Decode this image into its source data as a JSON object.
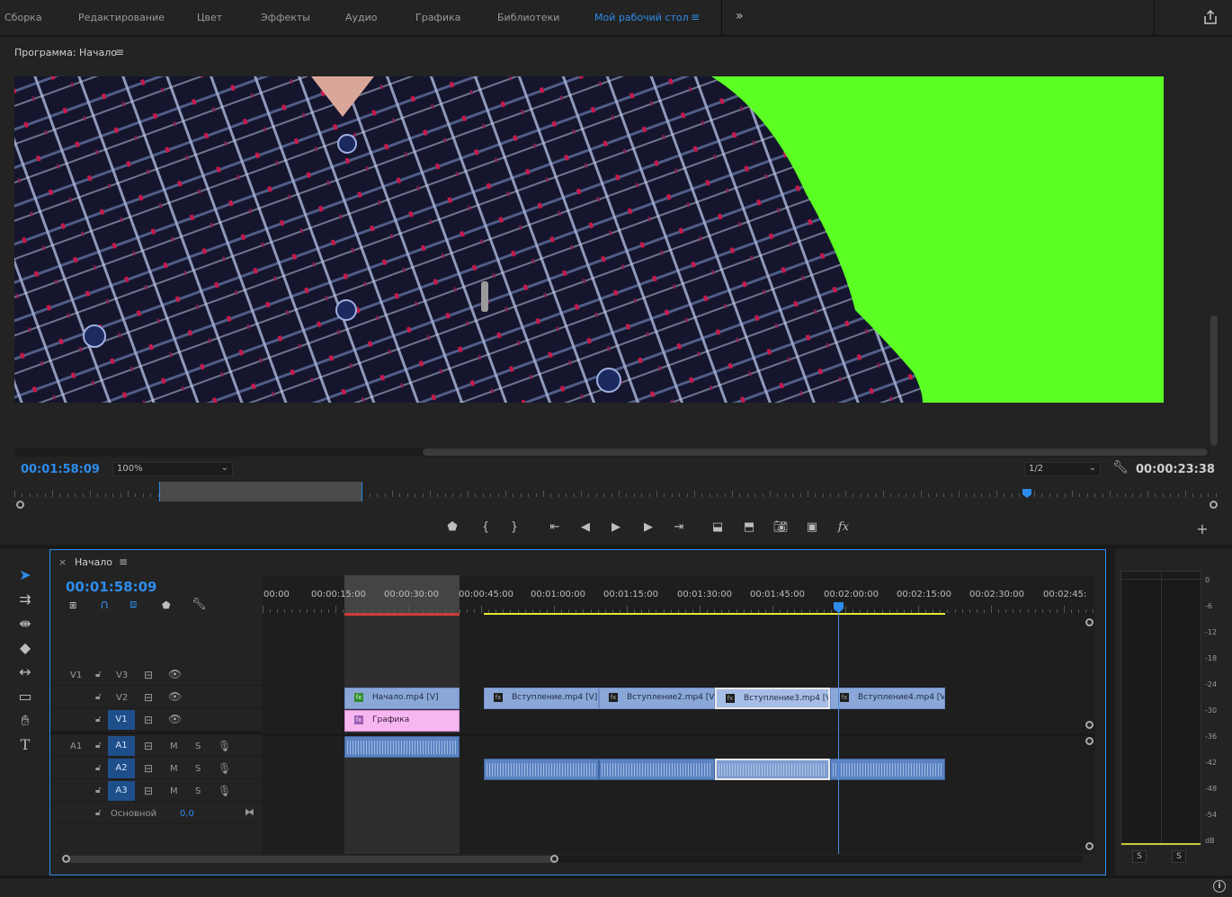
{
  "workspaces": [
    "Сборка",
    "Редактирование",
    "Цвет",
    "Эффекты",
    "Аудио",
    "Графика",
    "Библиотеки",
    "Мой рабочий стол"
  ],
  "active_workspace": "Мой рабочий стол",
  "program": {
    "title": "Программа: Начало",
    "current_timecode": "00:01:58:09",
    "zoom": "100%",
    "resolution": "1/2",
    "duration": "00:00:23:38"
  },
  "timeline": {
    "tab": "Начало",
    "timecode": "00:01:58:09",
    "ruler": [
      "00:00",
      "00:00:15:00",
      "00:00:30:00",
      "00:00:45:00",
      "00:01:00:00",
      "00:01:15:00",
      "00:01:30:00",
      "00:01:45:00",
      "00:02:00:00",
      "00:02:15:00",
      "00:02:30:00",
      "00:02:45:"
    ],
    "video_tracks": [
      {
        "src": "V1",
        "name": "V3"
      },
      {
        "src": "",
        "name": "V2"
      },
      {
        "src": "",
        "name": "V1",
        "selected": true
      }
    ],
    "audio_tracks": [
      {
        "src": "A1",
        "name": "A1",
        "selected": true
      },
      {
        "src": "",
        "name": "A2",
        "selected": true
      },
      {
        "src": "",
        "name": "A3",
        "selected": true
      }
    ],
    "master": {
      "label": "Основной",
      "value": "0,0"
    },
    "button_m": "M",
    "button_s": "S",
    "clips_v2": [
      "Начало.mp4 [V]",
      "Вступление.mp4 [V]",
      "Вступление2.mp4 [V]",
      "Вступление3.mp4 [V",
      "Вступление4.mp4 [V]"
    ],
    "clip_graphics": "Графика",
    "fx_badge": "fx"
  },
  "meter": {
    "scale": [
      "0",
      "-6",
      "-12",
      "-18",
      "-24",
      "-30",
      "-36",
      "-42",
      "-48",
      "-54",
      "dB"
    ],
    "solo": [
      "S",
      "S"
    ]
  },
  "colors": {
    "accent": "#2d8ceb",
    "green_screen": "#5cff24"
  }
}
